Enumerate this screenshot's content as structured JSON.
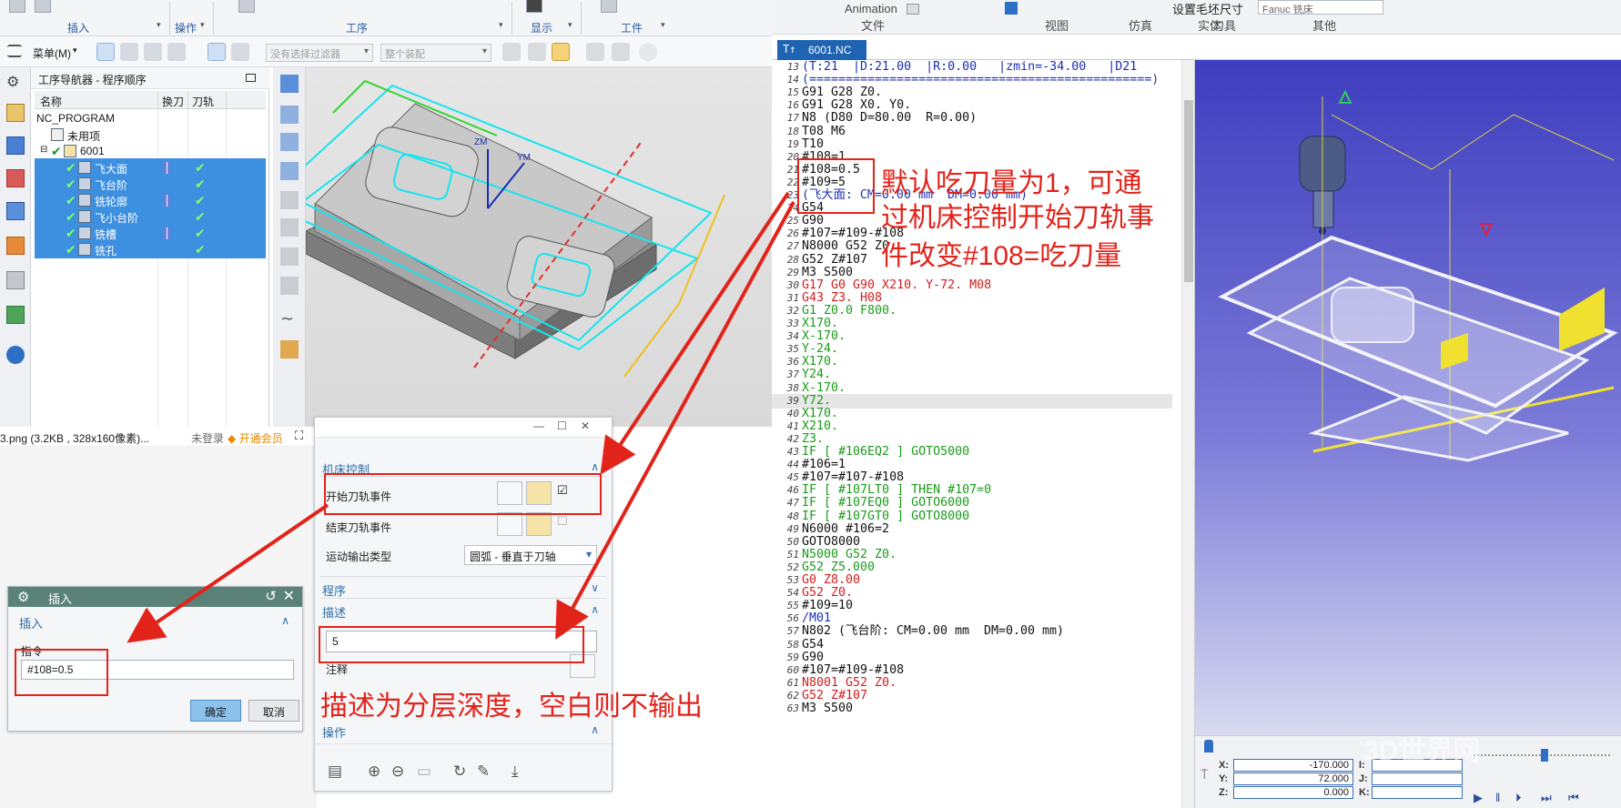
{
  "nx": {
    "ribbon": {
      "groups": [
        "插入",
        "操作",
        "工序",
        "显示",
        "工件"
      ]
    },
    "toolbar": {
      "menu_label": "菜单(M)",
      "filter_placeholder": "没有选择过滤器",
      "assembly_placeholder": "整个装配"
    },
    "navigator": {
      "title": "工序导航器 - 程序顺序",
      "columns": [
        "名称",
        "换刀",
        "刀轨"
      ],
      "rows": [
        {
          "name": "NC_PROGRAM",
          "selected": false
        },
        {
          "name": "未用项",
          "selected": false
        },
        {
          "name": "6001",
          "selected": false
        },
        {
          "name": "飞大面",
          "selected": true
        },
        {
          "name": "飞台阶",
          "selected": true
        },
        {
          "name": "铣轮廓",
          "selected": true
        },
        {
          "name": "飞小台阶",
          "selected": true
        },
        {
          "name": "铣槽",
          "selected": true
        },
        {
          "name": "铣孔",
          "selected": true
        }
      ]
    },
    "viewport": {
      "axis_labels": [
        "ZM",
        "YM"
      ]
    }
  },
  "viewer": {
    "filename": "3.png (3.2KB , 328x160像素)...",
    "login": "未登录",
    "member": "开通会员"
  },
  "insert_dialog": {
    "title": "插入",
    "section": "插入",
    "label": "指令",
    "value": "#108=0.5",
    "ok": "确定",
    "cancel": "取消"
  },
  "op_dialog": {
    "sections": {
      "machine_control": "机床控制",
      "program": "程序",
      "description": "描述",
      "operation": "操作"
    },
    "start_event": "开始刀轨事件",
    "end_event": "结束刀轨事件",
    "motion_output_label": "运动输出类型",
    "motion_output_value": "圆弧 - 垂直于刀轴",
    "description_value": "5",
    "comment_label": "注释"
  },
  "annotations": {
    "top": [
      "默认吃刀量为1，可通",
      "过机床控制开始刀轨事",
      "件改变#108=吃刀量"
    ],
    "bottom": "描述为分层深度，空白则不输出"
  },
  "vericut": {
    "ribbon_labels": [
      "Animation",
      "文件",
      "视图",
      "仿真",
      "刀具",
      "设置毛坯尺寸",
      "实体",
      "其他"
    ],
    "machine_select": "Fanuc 铣床",
    "tab": "6001.NC",
    "code": [
      {
        "n": "13",
        "t": "(T:21  |D:21.00  |R:0.00   |zmin=-34.00   |D21       )",
        "c": "blue"
      },
      {
        "n": "14",
        "t": "(===============================================)",
        "c": "blue"
      },
      {
        "n": "15",
        "t": "G91 G28 Z0.",
        "c": "black"
      },
      {
        "n": "16",
        "t": "G91 G28 X0. Y0.",
        "c": "black"
      },
      {
        "n": "17",
        "t": "N8 (D80 D=80.00  R=0.00)",
        "c": "black"
      },
      {
        "n": "18",
        "t": "T08 M6",
        "c": "black"
      },
      {
        "n": "19",
        "t": "T10",
        "c": "black"
      },
      {
        "n": "20",
        "t": "#108=1",
        "c": "black"
      },
      {
        "n": "21",
        "t": "#108=0.5",
        "c": "black"
      },
      {
        "n": "22",
        "t": "#109=5",
        "c": "black"
      },
      {
        "n": "23",
        "t": "(飞大面: CM=0.00 mm  DM=0.00 mm)",
        "c": "blue"
      },
      {
        "n": "24",
        "t": "G54",
        "c": "black"
      },
      {
        "n": "25",
        "t": "G90",
        "c": "black"
      },
      {
        "n": "26",
        "t": "#107=#109-#108",
        "c": "black"
      },
      {
        "n": "27",
        "t": "N8000 G52 Z0.",
        "c": "black"
      },
      {
        "n": "28",
        "t": "G52 Z#107",
        "c": "black"
      },
      {
        "n": "29",
        "t": "M3 S500",
        "c": "black"
      },
      {
        "n": "30",
        "t": "G17 G0 G90 X210. Y-72. M08",
        "c": "red"
      },
      {
        "n": "31",
        "t": "G43 Z3. H08",
        "c": "red"
      },
      {
        "n": "32",
        "t": "G1 Z0.0 F800.",
        "c": "green"
      },
      {
        "n": "33",
        "t": "X170.",
        "c": "green"
      },
      {
        "n": "34",
        "t": "X-170.",
        "c": "green"
      },
      {
        "n": "35",
        "t": "Y-24.",
        "c": "green"
      },
      {
        "n": "36",
        "t": "X170.",
        "c": "green"
      },
      {
        "n": "37",
        "t": "Y24.",
        "c": "green"
      },
      {
        "n": "38",
        "t": "X-170.",
        "c": "green"
      },
      {
        "n": "39",
        "t": "Y72.",
        "c": "green",
        "hl": true
      },
      {
        "n": "40",
        "t": "X170.",
        "c": "green"
      },
      {
        "n": "41",
        "t": "X210.",
        "c": "green"
      },
      {
        "n": "42",
        "t": "Z3.",
        "c": "green"
      },
      {
        "n": "43",
        "t": "IF [ #106EQ2 ] GOTO5000",
        "c": "green"
      },
      {
        "n": "44",
        "t": "#106=1",
        "c": "black"
      },
      {
        "n": "45",
        "t": "#107=#107-#108",
        "c": "black"
      },
      {
        "n": "46",
        "t": "IF [ #107LT0 ] THEN #107=0",
        "c": "green"
      },
      {
        "n": "47",
        "t": "IF [ #107EQ0 ] GOTO6000",
        "c": "green"
      },
      {
        "n": "48",
        "t": "IF [ #107GT0 ] GOTO8000",
        "c": "green"
      },
      {
        "n": "49",
        "t": "N6000 #106=2",
        "c": "black"
      },
      {
        "n": "50",
        "t": "GOTO8000",
        "c": "black"
      },
      {
        "n": "51",
        "t": "N5000 G52 Z0.",
        "c": "green"
      },
      {
        "n": "52",
        "t": "G52 Z5.000",
        "c": "green"
      },
      {
        "n": "53",
        "t": "G0 Z8.00",
        "c": "red"
      },
      {
        "n": "54",
        "t": "G52 Z0.",
        "c": "red"
      },
      {
        "n": "55",
        "t": "#109=10",
        "c": "black"
      },
      {
        "n": "56",
        "t": "/M01",
        "c": "blue"
      },
      {
        "n": "57",
        "t": "N802 (飞台阶: CM=0.00 mm  DM=0.00 mm)",
        "c": "black"
      },
      {
        "n": "58",
        "t": "G54",
        "c": "black"
      },
      {
        "n": "59",
        "t": "G90",
        "c": "black"
      },
      {
        "n": "60",
        "t": "#107=#109-#108",
        "c": "black"
      },
      {
        "n": "61",
        "t": "N8001 G52 Z0.",
        "c": "red"
      },
      {
        "n": "62",
        "t": "G52 Z#107",
        "c": "red"
      },
      {
        "n": "63",
        "t": "M3 S500",
        "c": "black"
      }
    ],
    "status": {
      "X": "-170.000",
      "Y": "72.000",
      "Z": "0.000",
      "I": "",
      "J": "",
      "K": ""
    },
    "watermark": "3D世界网"
  }
}
